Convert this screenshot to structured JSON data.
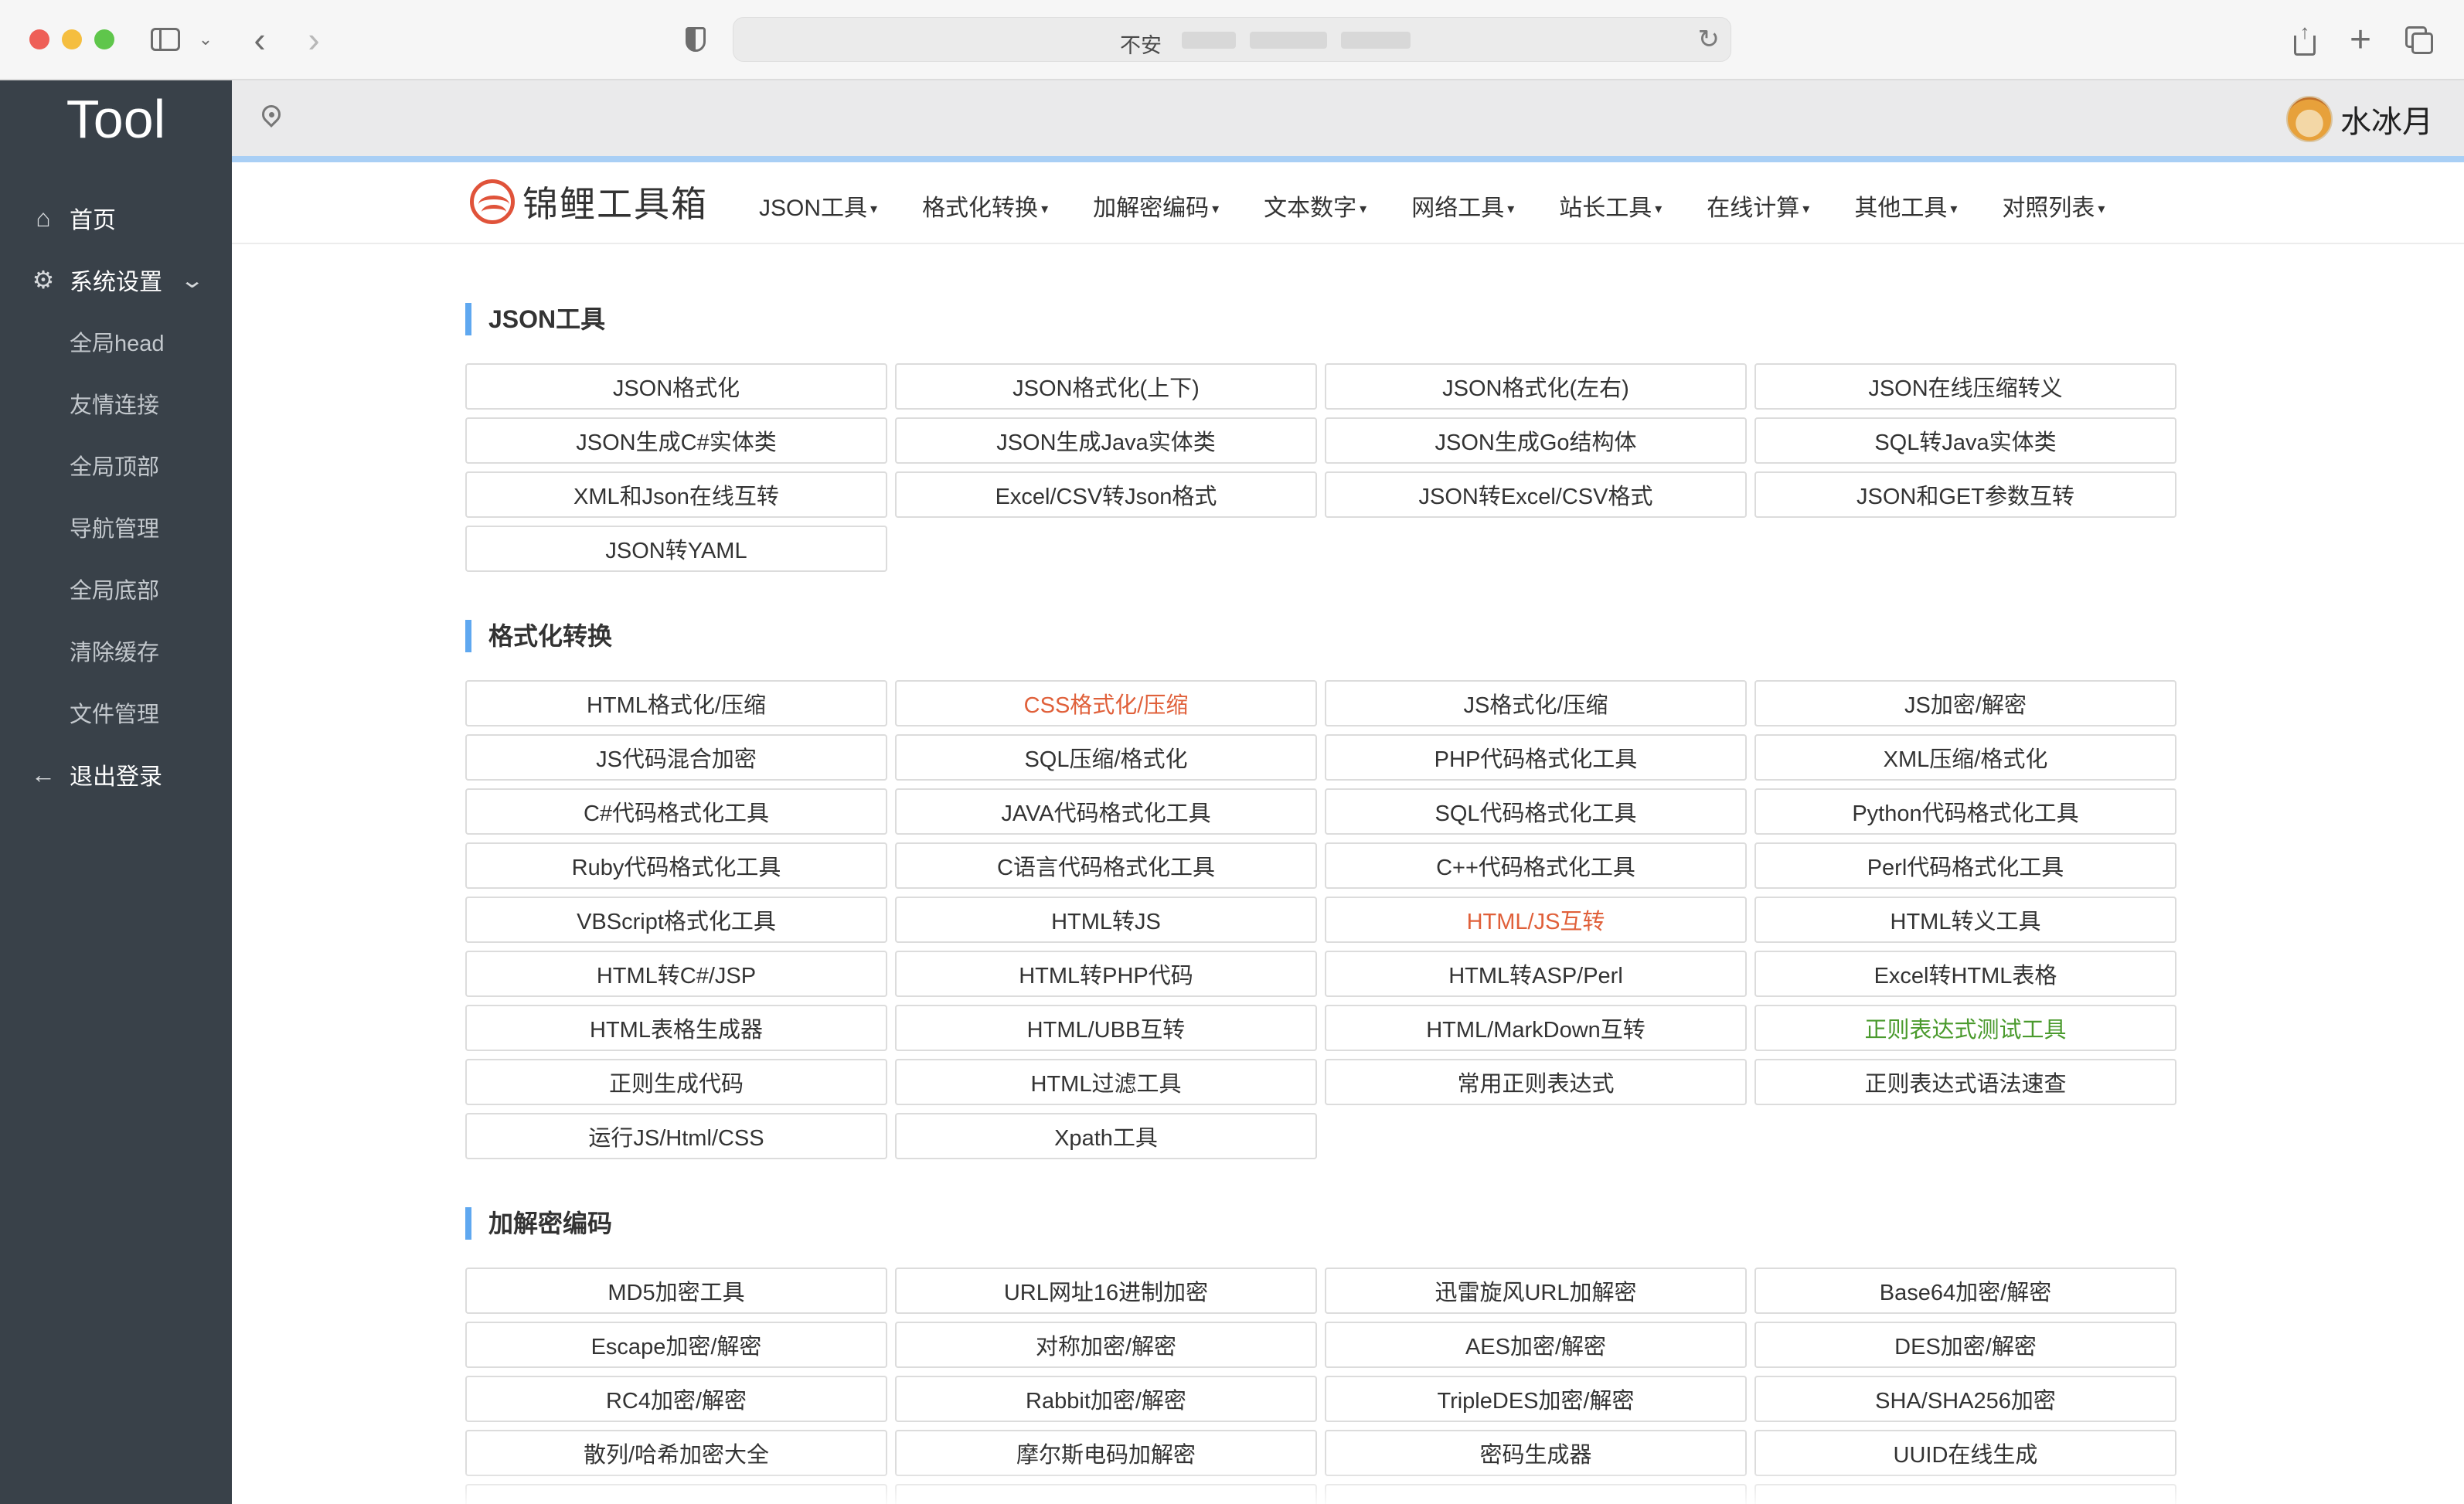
{
  "browser": {
    "address_text": "不安",
    "icons": [
      "sidebar-icon",
      "chevron-down-icon",
      "back-icon",
      "forward-icon",
      "privacy-shield-icon",
      "reload-icon",
      "share-icon",
      "new-tab-icon",
      "tab-overview-icon"
    ]
  },
  "sidebar": {
    "brand": "Tool",
    "home": "首页",
    "settings": "系统设置",
    "sub_items": [
      "全局head",
      "友情连接",
      "全局顶部",
      "导航管理",
      "全局底部",
      "清除缓存",
      "文件管理"
    ],
    "logout": "退出登录"
  },
  "header": {
    "user_name": "水冰月"
  },
  "site": {
    "logo_text": "锦鲤工具箱",
    "menu": [
      "JSON工具",
      "格式化转换",
      "加解密编码",
      "文本数字",
      "网络工具",
      "站长工具",
      "在线计算",
      "其他工具",
      "对照列表"
    ]
  },
  "sections": [
    {
      "title": "JSON工具",
      "tools": [
        {
          "label": "JSON格式化"
        },
        {
          "label": "JSON格式化(上下)"
        },
        {
          "label": "JSON格式化(左右)"
        },
        {
          "label": "JSON在线压缩转义"
        },
        {
          "label": "JSON生成C#实体类"
        },
        {
          "label": "JSON生成Java实体类"
        },
        {
          "label": "JSON生成Go结构体"
        },
        {
          "label": "SQL转Java实体类"
        },
        {
          "label": "XML和Json在线互转"
        },
        {
          "label": "Excel/CSV转Json格式"
        },
        {
          "label": "JSON转Excel/CSV格式"
        },
        {
          "label": "JSON和GET参数互转"
        },
        {
          "label": "JSON转YAML"
        }
      ]
    },
    {
      "title": "格式化转换",
      "tools": [
        {
          "label": "HTML格式化/压缩"
        },
        {
          "label": "CSS格式化/压缩",
          "color": "#e0603a"
        },
        {
          "label": "JS格式化/压缩"
        },
        {
          "label": "JS加密/解密"
        },
        {
          "label": "JS代码混合加密"
        },
        {
          "label": "SQL压缩/格式化"
        },
        {
          "label": "PHP代码格式化工具"
        },
        {
          "label": "XML压缩/格式化"
        },
        {
          "label": "C#代码格式化工具"
        },
        {
          "label": "JAVA代码格式化工具"
        },
        {
          "label": "SQL代码格式化工具"
        },
        {
          "label": "Python代码格式化工具"
        },
        {
          "label": "Ruby代码格式化工具"
        },
        {
          "label": "C语言代码格式化工具"
        },
        {
          "label": "C++代码格式化工具"
        },
        {
          "label": "Perl代码格式化工具"
        },
        {
          "label": "VBScript格式化工具"
        },
        {
          "label": "HTML转JS"
        },
        {
          "label": "HTML/JS互转",
          "color": "#e0603a"
        },
        {
          "label": "HTML转义工具"
        },
        {
          "label": "HTML转C#/JSP"
        },
        {
          "label": "HTML转PHP代码"
        },
        {
          "label": "HTML转ASP/Perl"
        },
        {
          "label": "Excel转HTML表格"
        },
        {
          "label": "HTML表格生成器"
        },
        {
          "label": "HTML/UBB互转"
        },
        {
          "label": "HTML/MarkDown互转"
        },
        {
          "label": "正则表达式测试工具",
          "color": "#4a9a2d"
        },
        {
          "label": "正则生成代码"
        },
        {
          "label": "HTML过滤工具"
        },
        {
          "label": "常用正则表达式"
        },
        {
          "label": "正则表达式语法速查"
        },
        {
          "label": "运行JS/Html/CSS"
        },
        {
          "label": "Xpath工具"
        }
      ]
    },
    {
      "title": "加解密编码",
      "tools": [
        {
          "label": "MD5加密工具"
        },
        {
          "label": "URL网址16进制加密"
        },
        {
          "label": "迅雷旋风URL加解密"
        },
        {
          "label": "Base64加密/解密"
        },
        {
          "label": "Escape加密/解密"
        },
        {
          "label": "对称加密/解密"
        },
        {
          "label": "AES加密/解密"
        },
        {
          "label": "DES加密/解密"
        },
        {
          "label": "RC4加密/解密"
        },
        {
          "label": "Rabbit加密/解密"
        },
        {
          "label": "TripleDES加密/解密"
        },
        {
          "label": "SHA/SHA256加密"
        },
        {
          "label": "散列/哈希加密大全"
        },
        {
          "label": "摩尔斯电码加解密"
        },
        {
          "label": "密码生成器"
        },
        {
          "label": "UUID在线生成"
        },
        {
          "label": ""
        },
        {
          "label": ""
        },
        {
          "label": ""
        },
        {
          "label": ""
        }
      ]
    }
  ]
}
